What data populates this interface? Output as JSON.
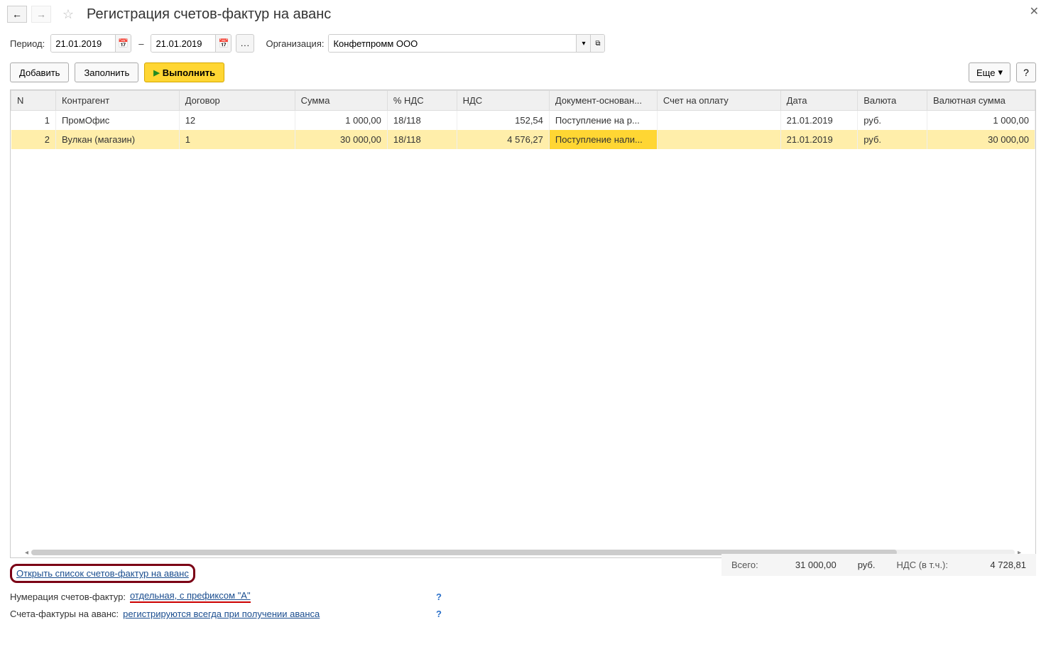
{
  "title": "Регистрация счетов-фактур на аванс",
  "params": {
    "period_label": "Период:",
    "date_from": "21.01.2019",
    "date_to": "21.01.2019",
    "org_label": "Организация:",
    "org_value": "Конфетпромм ООО"
  },
  "toolbar": {
    "add": "Добавить",
    "fill": "Заполнить",
    "execute": "Выполнить",
    "more": "Еще",
    "help": "?"
  },
  "columns": {
    "n": "N",
    "kontragent": "Контрагент",
    "dogovor": "Договор",
    "summa": "Сумма",
    "nds_percent": "% НДС",
    "nds": "НДС",
    "basis": "Документ-основан...",
    "schet": "Счет на оплату",
    "date": "Дата",
    "currency": "Валюта",
    "cur_sum": "Валютная сумма"
  },
  "rows": [
    {
      "n": "1",
      "kontragent": "ПромОфис",
      "dogovor": "12",
      "summa": "1 000,00",
      "nds_percent": "18/118",
      "nds": "152,54",
      "basis": "Поступление на р...",
      "schet": "",
      "date": "21.01.2019",
      "currency": "руб.",
      "cur_sum": "1 000,00"
    },
    {
      "n": "2",
      "kontragent": "Вулкан (магазин)",
      "dogovor": "1",
      "summa": "30 000,00",
      "nds_percent": "18/118",
      "nds": "4 576,27",
      "basis": "Поступление нали...",
      "schet": "",
      "date": "21.01.2019",
      "currency": "руб.",
      "cur_sum": "30 000,00"
    }
  ],
  "footer": {
    "open_list_link": "Открыть список счетов-фактур на аванс",
    "numbering_label": "Нумерация счетов-фактур:",
    "numbering_link": "отдельная, с префиксом \"А\"",
    "sf_label": "Счета-фактуры на аванс:",
    "sf_link": "регистрируются всегда при получении аванса"
  },
  "summary": {
    "total_label": "Всего:",
    "total": "31 000,00",
    "total_cur": "руб.",
    "nds_label": "НДС (в т.ч.):",
    "nds": "4 728,81"
  }
}
